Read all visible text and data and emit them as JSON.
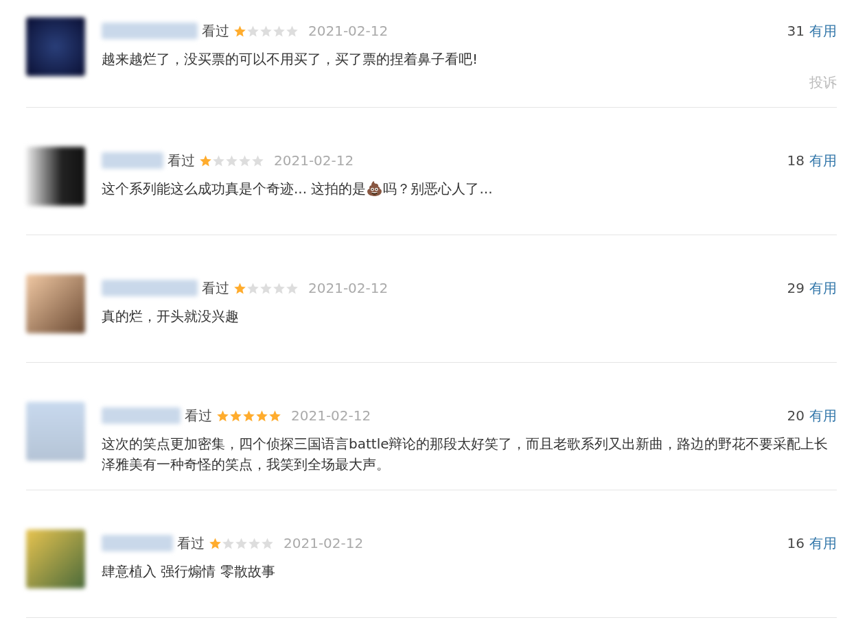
{
  "comments": [
    {
      "watched": "看过",
      "stars": 1,
      "date": "2021-02-12",
      "votes": "31",
      "useful": "有用",
      "text": "越来越烂了，没买票的可以不用买了，买了票的捏着鼻子看吧!",
      "complain": "投诉"
    },
    {
      "watched": "看过",
      "stars": 1,
      "date": "2021-02-12",
      "votes": "18",
      "useful": "有用",
      "text": "这个系列能这么成功真是个奇迹... 这拍的是💩吗？别恶心人了..."
    },
    {
      "watched": "看过",
      "stars": 1,
      "date": "2021-02-12",
      "votes": "29",
      "useful": "有用",
      "text": "真的烂，开头就没兴趣"
    },
    {
      "watched": "看过",
      "stars": 5,
      "date": "2021-02-12",
      "votes": "20",
      "useful": "有用",
      "text": "这次的笑点更加密集，四个侦探三国语言battle辩论的那段太好笑了，而且老歌系列又出新曲，路边的野花不要采配上长泽雅美有一种奇怪的笑点，我笑到全场最大声。"
    },
    {
      "watched": "看过",
      "stars": 1,
      "date": "2021-02-12",
      "votes": "16",
      "useful": "有用",
      "text": "肆意植入 强行煽情 零散故事"
    }
  ]
}
